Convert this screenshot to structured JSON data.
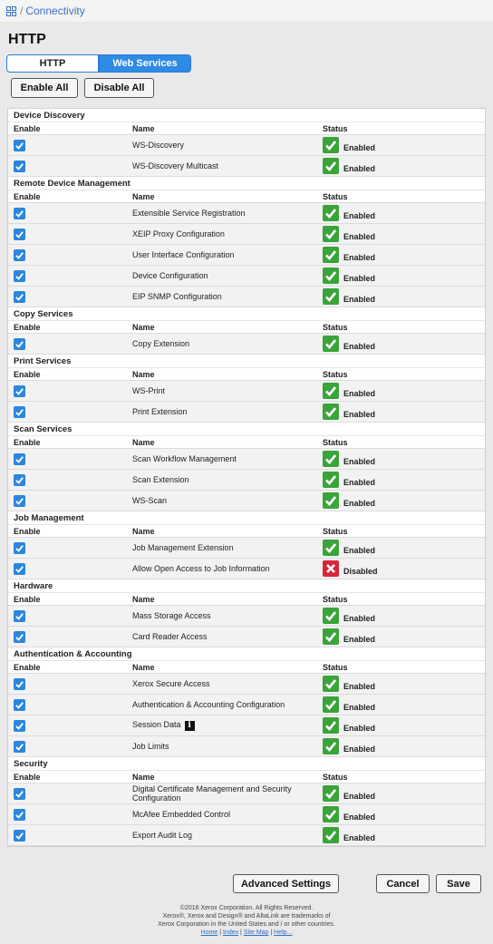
{
  "breadcrumb": {
    "label": "Connectivity"
  },
  "page_title": "HTTP",
  "tabs": [
    {
      "label": "HTTP",
      "active": false
    },
    {
      "label": "Web Services",
      "active": true
    }
  ],
  "actions": {
    "enable_all": "Enable All",
    "disable_all": "Disable All"
  },
  "columns": {
    "enable": "Enable",
    "name": "Name",
    "status": "Status"
  },
  "sections": [
    {
      "title": "Device Discovery",
      "rows": [
        {
          "name": "WS-Discovery",
          "checked": true,
          "status": "Enabled"
        },
        {
          "name": "WS-Discovery Multicast",
          "checked": true,
          "status": "Enabled"
        }
      ]
    },
    {
      "title": "Remote Device Management",
      "rows": [
        {
          "name": "Extensible Service Registration",
          "checked": true,
          "status": "Enabled"
        },
        {
          "name": "XEIP Proxy Configuration",
          "checked": true,
          "status": "Enabled"
        },
        {
          "name": "User Interface Configuration",
          "checked": true,
          "status": "Enabled"
        },
        {
          "name": "Device Configuration",
          "checked": true,
          "status": "Enabled"
        },
        {
          "name": "EIP SNMP Configuration",
          "checked": true,
          "status": "Enabled"
        }
      ]
    },
    {
      "title": "Copy Services",
      "rows": [
        {
          "name": "Copy Extension",
          "checked": true,
          "status": "Enabled"
        }
      ]
    },
    {
      "title": "Print Services",
      "rows": [
        {
          "name": "WS-Print",
          "checked": true,
          "status": "Enabled"
        },
        {
          "name": "Print Extension",
          "checked": true,
          "status": "Enabled"
        }
      ]
    },
    {
      "title": "Scan Services",
      "rows": [
        {
          "name": "Scan Workflow Management",
          "checked": true,
          "status": "Enabled"
        },
        {
          "name": "Scan Extension",
          "checked": true,
          "status": "Enabled"
        },
        {
          "name": "WS-Scan",
          "checked": true,
          "status": "Enabled"
        }
      ]
    },
    {
      "title": "Job Management",
      "rows": [
        {
          "name": "Job Management Extension",
          "checked": true,
          "status": "Enabled"
        },
        {
          "name": "Allow Open Access to Job Information",
          "checked": true,
          "status": "Disabled"
        }
      ]
    },
    {
      "title": "Hardware",
      "rows": [
        {
          "name": "Mass Storage Access",
          "checked": true,
          "status": "Enabled"
        },
        {
          "name": "Card Reader Access",
          "checked": true,
          "status": "Enabled"
        }
      ]
    },
    {
      "title": "Authentication & Accounting",
      "rows": [
        {
          "name": "Xerox Secure Access",
          "checked": true,
          "status": "Enabled"
        },
        {
          "name": "Authentication & Accounting Configuration",
          "checked": true,
          "status": "Enabled"
        },
        {
          "name": "Session Data",
          "checked": true,
          "status": "Enabled",
          "info_icon": "info-icon"
        },
        {
          "name": "Job Limits",
          "checked": true,
          "status": "Enabled"
        }
      ]
    },
    {
      "title": "Security",
      "rows": [
        {
          "name": "Digital Certificate Management and Security Configuration",
          "checked": true,
          "status": "Enabled"
        },
        {
          "name": "McAfee Embedded Control",
          "checked": true,
          "status": "Enabled"
        },
        {
          "name": "Export Audit Log",
          "checked": true,
          "status": "Enabled"
        }
      ]
    }
  ],
  "buttons": {
    "advanced": "Advanced Settings",
    "cancel": "Cancel",
    "save": "Save"
  },
  "footer": {
    "line1": "©2016 Xerox Corporation. All Rights Reserved.",
    "line2": "Xerox®, Xerox and Design® and AltaLink are trademarks of",
    "line3": "Xerox Corporation in the United States and / or other countries.",
    "links": [
      "Home",
      "Index",
      "Site Map",
      "Help..."
    ]
  },
  "colors": {
    "accent": "#2d8be5",
    "enabled": "#3aa43a",
    "disabled": "#d9253a"
  }
}
